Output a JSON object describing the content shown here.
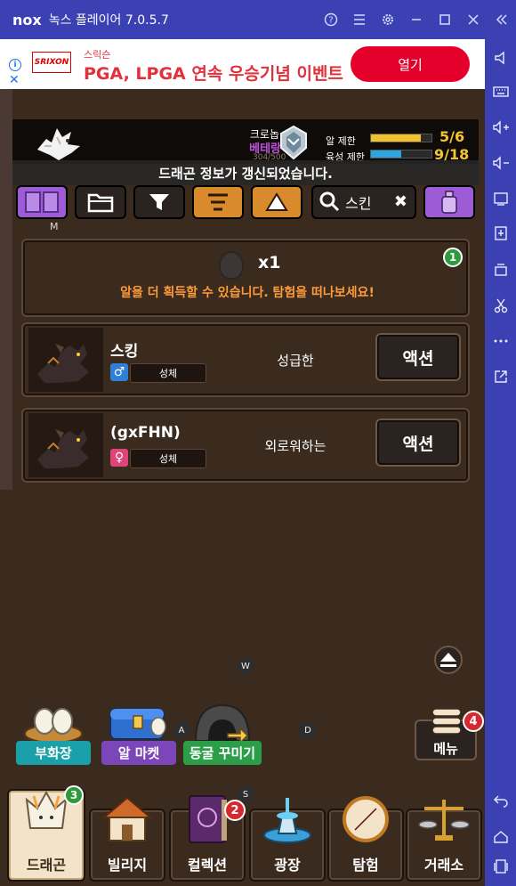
{
  "titlebar": {
    "logo": "nox",
    "title": "녹스 플레이어 7.0.5.7",
    "icons": [
      "help-icon",
      "menu-icon",
      "settings-icon",
      "minimize-icon",
      "maximize-icon",
      "close-icon",
      "collapse-icon"
    ]
  },
  "sidebar": {
    "icons": [
      "volume-icon",
      "keyboard-icon",
      "volume-up-icon",
      "volume-down-icon",
      "screen-icon",
      "apk-icon",
      "multi-instance-icon",
      "scissors-icon",
      "more-icon",
      "external-icon",
      "back-icon",
      "home-icon",
      "recent-apps-icon"
    ]
  },
  "ad": {
    "logo_text": "SRIXON",
    "brand": "스릭슨",
    "headline": "PGA, LPGA 연속 우승기념 이벤트",
    "cta": "열기",
    "info": "i",
    "close": "✕"
  },
  "status": {
    "rank_name": "크로놉",
    "rank_tier": "베테랑",
    "rank_sub": "304/500",
    "egg_limit_label": "알 제한",
    "egg_limit_value": "5/6",
    "egg_limit_ratio": 0.83,
    "nurture_limit_label": "육성 제한",
    "nurture_limit_value": "9/18",
    "nurture_limit_ratio": 0.5,
    "colors": {
      "egg_bar": "#f0c12c",
      "nurture_bar": "#2aa7e0",
      "value": "#f5c530"
    }
  },
  "notice": "드래곤 정보가 갱신되었습니다.",
  "toolbar": {
    "search_placeholder": "스킨",
    "clear": "✖",
    "key_hint": "M"
  },
  "egg_card": {
    "count": "x1",
    "message": "알을 더 획득할 수 있습니다. 탐험을 떠나보세요!",
    "badge": "1"
  },
  "dragons": [
    {
      "name": "스킹",
      "gender": "♂",
      "stage": "성체",
      "personality": "성급한",
      "action": "액션"
    },
    {
      "name": "(gxFHN)",
      "gender": "♀",
      "stage": "성체",
      "personality": "외로워하는",
      "action": "액션"
    }
  ],
  "key_hints": {
    "w": "W",
    "a": "A",
    "s": "S",
    "d": "D"
  },
  "actions": [
    {
      "label": "부화장"
    },
    {
      "label": "알 마켓"
    },
    {
      "label": "동굴 꾸미기"
    }
  ],
  "menu": {
    "label": "메뉴",
    "badge": "4"
  },
  "nav": [
    {
      "label": "드래곤",
      "badge": "3"
    },
    {
      "label": "빌리지"
    },
    {
      "label": "컬렉션",
      "badge": "2"
    },
    {
      "label": "광장"
    },
    {
      "label": "탐험"
    },
    {
      "label": "거래소"
    }
  ]
}
